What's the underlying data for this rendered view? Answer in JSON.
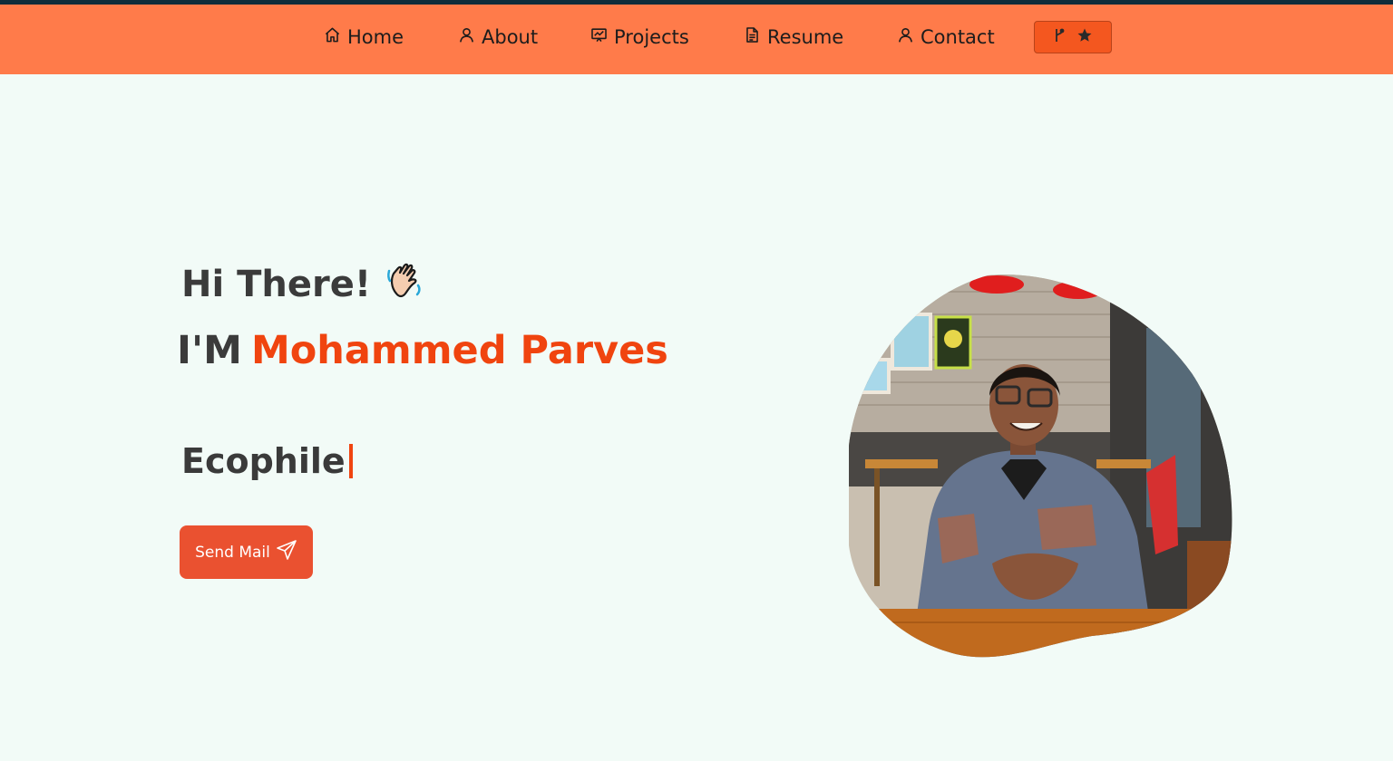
{
  "nav": {
    "items": [
      {
        "label": "Home",
        "icon": "home-icon"
      },
      {
        "label": "About",
        "icon": "user-icon"
      },
      {
        "label": "Projects",
        "icon": "presentation-icon"
      },
      {
        "label": "Resume",
        "icon": "document-icon"
      },
      {
        "label": "Contact",
        "icon": "user-icon"
      }
    ],
    "github_button_icons": [
      "git-fork-icon",
      "star-icon"
    ]
  },
  "hero": {
    "greeting": "Hi There!",
    "greeting_icon": "waving-hand-icon",
    "intro_prefix": "I'M",
    "name": "Mohammed Parves",
    "typed_role": "Ecophile",
    "send_button": {
      "label": "Send Mail",
      "icon": "paper-plane-icon"
    },
    "photo_alt": "profile-photo"
  },
  "colors": {
    "navbar": "#ff7b4a",
    "top_line": "#0f2d3b",
    "accent": "#f0440f",
    "button": "#ea5130",
    "background": "#f2fbf7",
    "text": "#3b3b3b"
  }
}
